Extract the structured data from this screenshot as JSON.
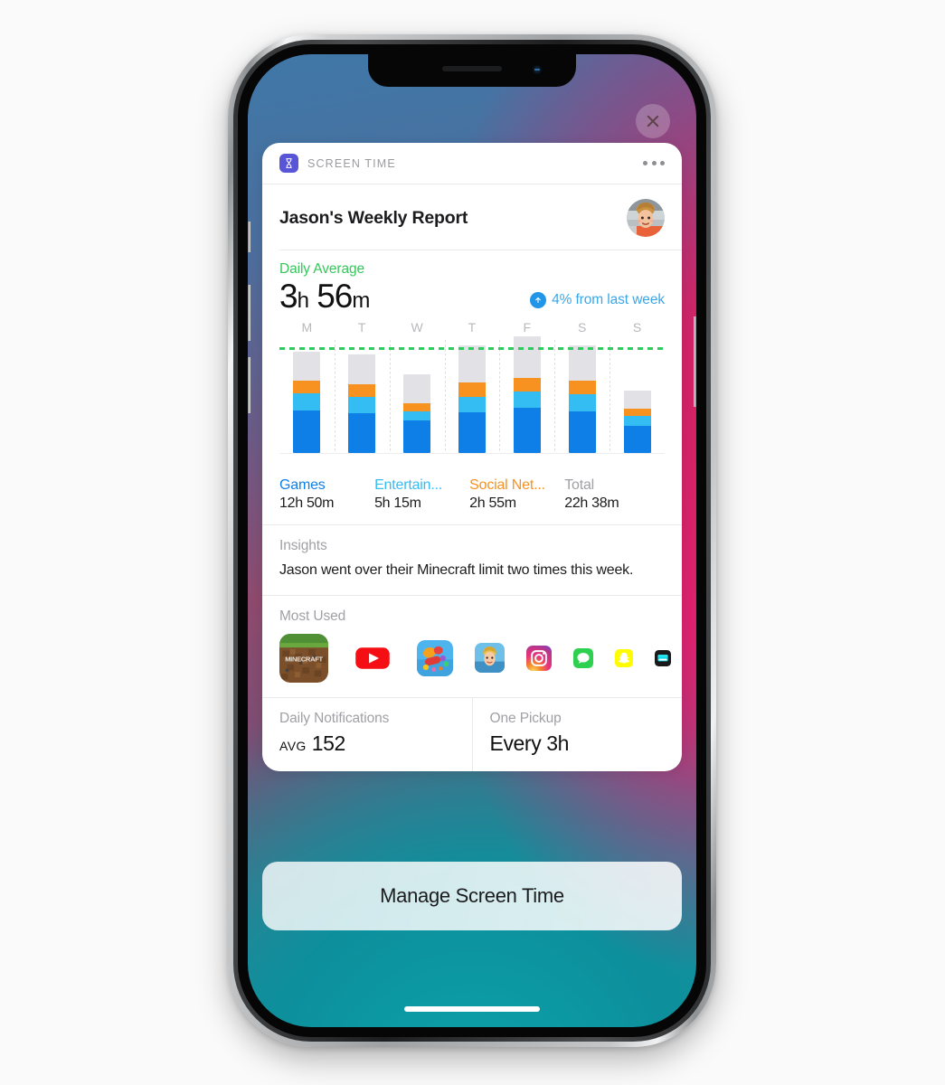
{
  "device": {
    "close_button_icon": "close-icon",
    "home_indicator": "home-indicator"
  },
  "card": {
    "app_icon": "hourglass-icon",
    "app_name": "SCREEN TIME",
    "more_icon": "more-options-icon",
    "title": "Jason's Weekly Report",
    "avatar": "user-avatar"
  },
  "summary": {
    "label": "Daily Average",
    "hours": "3",
    "hours_unit": "h",
    "minutes": "56",
    "minutes_unit": "m",
    "delta_icon": "arrow-up-icon",
    "delta_text": "4% from last week",
    "label_color": "#34c759",
    "delta_color": "#3aa7e8"
  },
  "legend": [
    {
      "name": "Games",
      "value": "12h 50m",
      "color": "#0f7fe8"
    },
    {
      "name": "Entertain...",
      "value": "5h 15m",
      "color": "#34bdf2"
    },
    {
      "name": "Social Net...",
      "value": "2h 55m",
      "color": "#f79220"
    },
    {
      "name": "Total",
      "value": "22h 38m",
      "color": "#a0a0a5"
    }
  ],
  "insights": {
    "label": "Insights",
    "text": "Jason went over their Minecraft limit two times this week."
  },
  "most_used": {
    "label": "Most Used",
    "apps": [
      {
        "name": "minecraft-app-icon",
        "size": 54
      },
      {
        "name": "youtube-app-icon",
        "size": 50
      },
      {
        "name": "candycrush-app-icon",
        "size": 40
      },
      {
        "name": "photos-app-icon",
        "size": 33
      },
      {
        "name": "instagram-app-icon",
        "size": 28
      },
      {
        "name": "messages-app-icon",
        "size": 22
      },
      {
        "name": "snapchat-app-icon",
        "size": 20
      },
      {
        "name": "tv-app-icon",
        "size": 18
      }
    ]
  },
  "stats": [
    {
      "label": "Daily Notifications",
      "prefix": "AVG",
      "value": "152"
    },
    {
      "label": "One Pickup",
      "prefix": "",
      "value": "Every 3h"
    }
  ],
  "manage_button": {
    "label": "Manage Screen Time"
  },
  "chart_data": {
    "type": "bar",
    "stacked": true,
    "title": "Daily Average",
    "xlabel": "",
    "ylabel": "",
    "categories": [
      "M",
      "T",
      "W",
      "T",
      "F",
      "S",
      "S"
    ],
    "unit": "hours",
    "ylim": [
      0,
      6.2
    ],
    "grid": true,
    "legend_position": "below",
    "limit_line": {
      "label": "Daily Limit",
      "value": 5.6,
      "color": "#2ecc5e",
      "style": "dotted"
    },
    "series": [
      {
        "name": "Games",
        "color": "#0f7fe8",
        "values": [
          2.3,
          2.15,
          1.75,
          2.2,
          2.45,
          2.25,
          1.45
        ]
      },
      {
        "name": "Entertainment",
        "color": "#34bdf2",
        "values": [
          0.95,
          0.9,
          0.5,
          0.85,
          0.9,
          0.95,
          0.55
        ]
      },
      {
        "name": "Social Networking",
        "color": "#f79220",
        "values": [
          0.7,
          0.7,
          0.45,
          0.8,
          0.75,
          0.75,
          0.4
        ]
      },
      {
        "name": "Other",
        "color": "#e2e2e6",
        "values": [
          1.55,
          1.6,
          1.55,
          2.0,
          2.25,
          1.9,
          1.0
        ]
      }
    ],
    "totals": [
      5.5,
      5.35,
      4.25,
      5.85,
      6.35,
      5.85,
      3.4
    ],
    "totals_label": "22h 38m",
    "daily_average": "3h 56m",
    "change_from_last_week": "+4%"
  }
}
